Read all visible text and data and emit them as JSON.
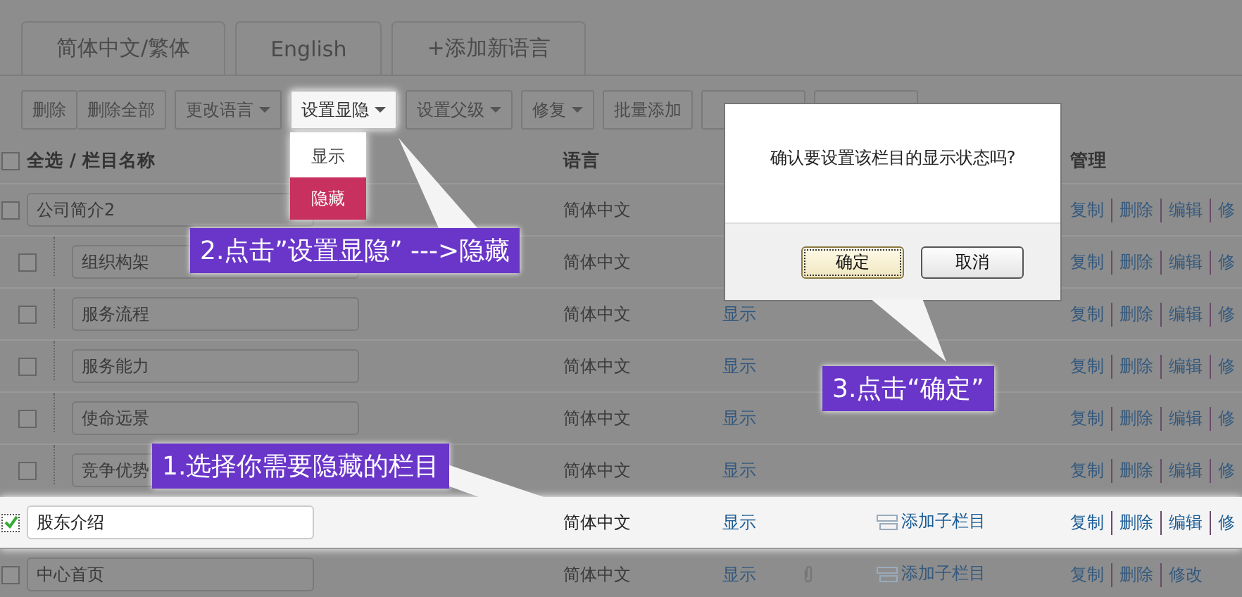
{
  "tabs": [
    {
      "label": "简体中文/繁体"
    },
    {
      "label": "English"
    },
    {
      "label": "+添加新语言"
    }
  ],
  "toolbar": [
    {
      "kind": "group",
      "buttons": [
        "删除",
        "删除全部"
      ]
    },
    {
      "kind": "dropdown",
      "label": "更改语言",
      "open": false
    },
    {
      "kind": "dropdown",
      "label": "设置显隐",
      "open": true,
      "menu": [
        {
          "label": "显示",
          "selected": false
        },
        {
          "label": "隐藏",
          "selected": true
        }
      ]
    },
    {
      "kind": "dropdown",
      "label": "设置父级",
      "open": false
    },
    {
      "kind": "dropdown",
      "label": "修复",
      "open": false
    },
    {
      "kind": "button",
      "label": "批量添加"
    },
    {
      "kind": "blank"
    },
    {
      "kind": "blank"
    }
  ],
  "table": {
    "header": {
      "checked": false,
      "name": "全选 / 栏目名称",
      "language": "语言",
      "manage": "管理"
    },
    "rows": [
      {
        "name": "公司简介2",
        "checked": false,
        "language": "简体中文",
        "actions": [
          "复制",
          "删除",
          "编辑",
          "修"
        ],
        "children": [
          {
            "name": "组织构架",
            "checked": false,
            "language": "简体中文",
            "actions": [
              "复制",
              "删除",
              "编辑",
              "修"
            ]
          },
          {
            "name": "服务流程",
            "checked": false,
            "language": "简体中文",
            "status": "显示",
            "actions": [
              "复制",
              "删除",
              "编辑",
              "修"
            ]
          },
          {
            "name": "服务能力",
            "checked": false,
            "language": "简体中文",
            "status": "显示",
            "actions": [
              "复制",
              "删除",
              "编辑",
              "修"
            ]
          },
          {
            "name": "使命远景",
            "checked": false,
            "language": "简体中文",
            "status": "显示",
            "actions": [
              "复制",
              "删除",
              "编辑",
              "修"
            ]
          },
          {
            "name": "竞争优势",
            "checked": false,
            "language": "简体中文",
            "status": "显示",
            "actions": [
              "复制",
              "删除",
              "编辑",
              "修"
            ]
          }
        ]
      },
      {
        "name": "股东介绍",
        "checked": true,
        "language": "简体中文",
        "status": "显示",
        "add_child": "添加子栏目",
        "actions": [
          "复制",
          "删除",
          "编辑",
          "修"
        ]
      },
      {
        "name": "中心首页",
        "checked": false,
        "language": "简体中文",
        "status": "显示",
        "attachment": true,
        "add_child": "添加子栏目",
        "actions": [
          "复制",
          "删除",
          "修改"
        ]
      }
    ]
  },
  "dialog": {
    "message": "确认要设置该栏目的显示状态吗?",
    "buttons": [
      {
        "label": "确定",
        "focused": true
      },
      {
        "label": "取消",
        "focused": false
      }
    ]
  },
  "callouts": [
    {
      "text": "2.点击”设置显隐” --->隐藏"
    },
    {
      "text": "3.点击“确定”"
    },
    {
      "text": "1.选择你需要隐藏的栏目"
    }
  ]
}
